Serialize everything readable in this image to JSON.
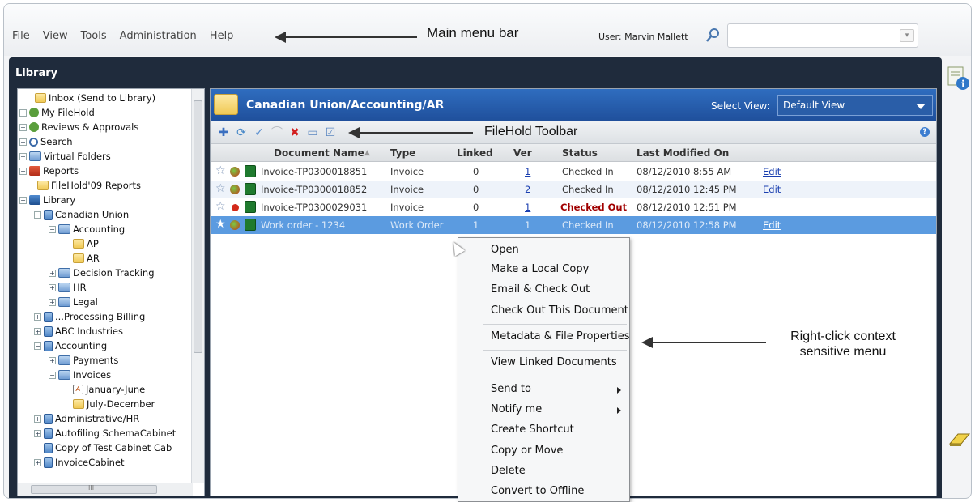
{
  "window": {
    "controls": "– ☐ ✕"
  },
  "menubar": {
    "items": [
      "File",
      "View",
      "Tools",
      "Administration",
      "Help"
    ],
    "annotation": "Main menu bar",
    "user_label": "User: Marvin Mallett",
    "search_value": ""
  },
  "library": {
    "title": "Library"
  },
  "tree": {
    "items": [
      {
        "label": "Inbox (Send to Library)"
      },
      {
        "label": "My FileHold"
      },
      {
        "label": "Reviews & Approvals"
      },
      {
        "label": "Search"
      },
      {
        "label": "Virtual Folders"
      },
      {
        "label": "Reports"
      },
      {
        "label": "FileHold'09 Reports"
      },
      {
        "label": "Library"
      },
      {
        "label": "Canadian Union"
      },
      {
        "label": "Accounting"
      },
      {
        "label": "AP"
      },
      {
        "label": "AR"
      },
      {
        "label": "Decision Tracking"
      },
      {
        "label": "HR"
      },
      {
        "label": "Legal"
      },
      {
        "label": "...Processing Billing"
      },
      {
        "label": "ABC Industries"
      },
      {
        "label": "Accounting"
      },
      {
        "label": "Payments"
      },
      {
        "label": "Invoices"
      },
      {
        "label": "January-June"
      },
      {
        "label": "July-December"
      },
      {
        "label": "Administrative/HR"
      },
      {
        "label": "Autofiling SchemaCabinet"
      },
      {
        "label": "Copy of Test Cabinet Cab"
      },
      {
        "label": "InvoiceCabinet"
      }
    ],
    "hscroll_label": "III"
  },
  "main": {
    "path": "Canadian Union/Accounting/AR",
    "select_view_label": "Select View:",
    "select_view_value": "Default View",
    "toolbar_annotation": "FileHold Toolbar",
    "columns": [
      "Document Name",
      "Type",
      "Linked",
      "Ver",
      "Status",
      "Last Modified On"
    ],
    "rows": [
      {
        "name": "Invoice-TP0300018851",
        "type": "Invoice",
        "linked": "0",
        "ver": "1",
        "status": "Checked In",
        "modified": "08/12/2010 8:55 AM",
        "edit": "Edit"
      },
      {
        "name": "Invoice-TP0300018852",
        "type": "Invoice",
        "linked": "0",
        "ver": "2",
        "status": "Checked In",
        "modified": "08/12/2010 12:45 PM",
        "edit": "Edit"
      },
      {
        "name": "Invoice-TP0300029031",
        "type": "Invoice",
        "linked": "0",
        "ver": "1",
        "status": "Checked Out",
        "modified": "08/12/2010 12:51 PM",
        "edit": ""
      },
      {
        "name": "Work order - 1234",
        "type": "Work Order",
        "linked": "1",
        "ver": "1",
        "status": "Checked In",
        "modified": "08/12/2010 12:58 PM",
        "edit": "Edit"
      }
    ]
  },
  "context_menu": {
    "items": [
      "Open",
      "Make a Local Copy",
      "Email & Check Out",
      "Check Out This Document",
      "Metadata & File Properties",
      "View Linked Documents",
      "Send to",
      "Notify me",
      "Create Shortcut",
      "Copy or Move",
      "Delete",
      "Convert to Offline"
    ],
    "annotation_line1": "Right-click context",
    "annotation_line2": "sensitive menu"
  },
  "colors": {
    "panel_bg": "#1f2b3c",
    "path_bar": "#2f6dbf",
    "selected_row": "#5b9be0",
    "checked_out": "#a00000",
    "link": "#1a3fb0"
  }
}
